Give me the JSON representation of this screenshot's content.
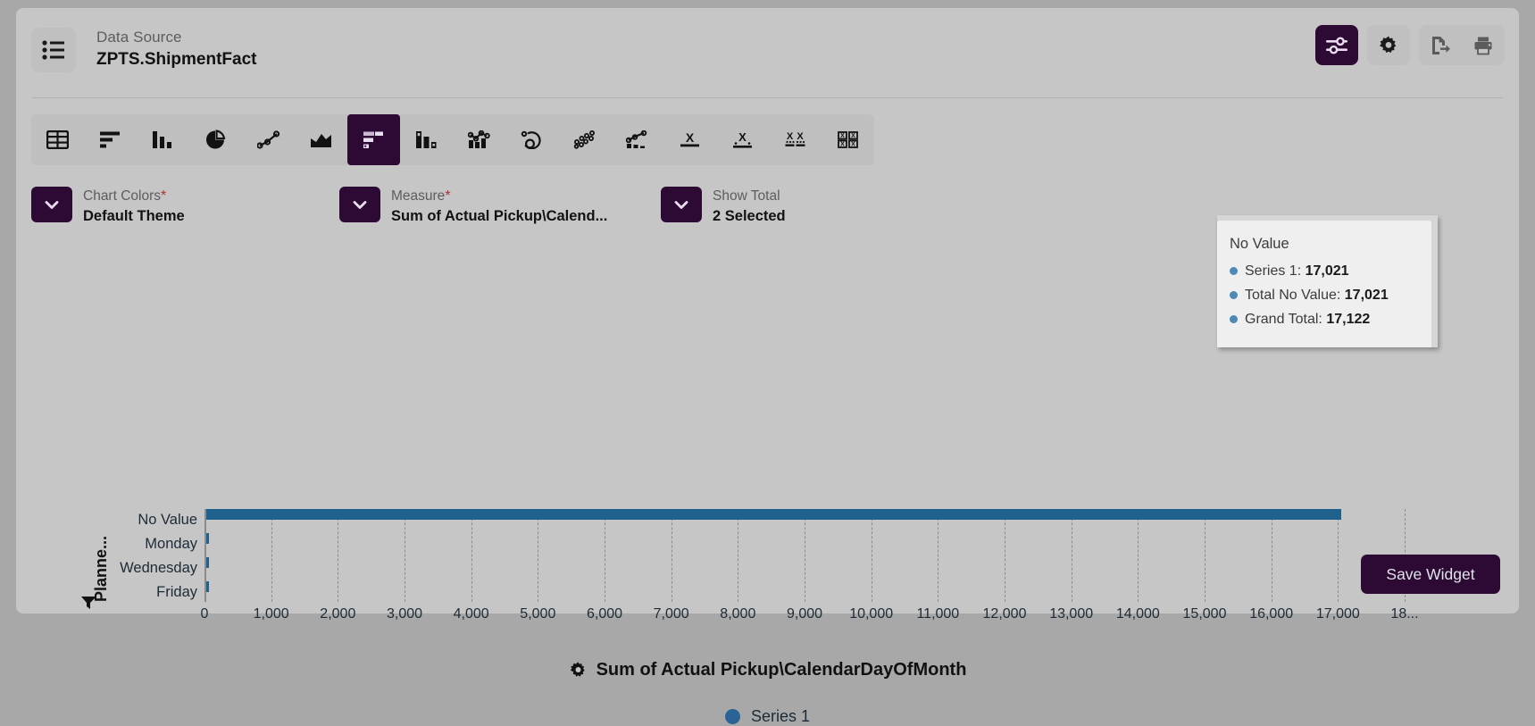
{
  "header": {
    "datasource_label": "Data Source",
    "datasource_value": "ZPTS.ShipmentFact",
    "list_icon": "list-icon",
    "actions": [
      {
        "name": "filter-settings-icon",
        "style": "accent"
      },
      {
        "name": "gear-icon",
        "style": "plain"
      },
      {
        "name": "export-icon",
        "style": "flat"
      },
      {
        "name": "print-icon",
        "style": "flat"
      }
    ]
  },
  "chart_types": [
    {
      "name": "table-chart-icon",
      "selected": false
    },
    {
      "name": "horizontal-bar-chart-icon",
      "selected": false
    },
    {
      "name": "column-chart-icon",
      "selected": false
    },
    {
      "name": "pie-chart-icon",
      "selected": false
    },
    {
      "name": "line-chart-icon",
      "selected": false
    },
    {
      "name": "area-chart-icon",
      "selected": false
    },
    {
      "name": "stacked-bar-chart-icon",
      "selected": true
    },
    {
      "name": "grouped-column-chart-icon",
      "selected": false
    },
    {
      "name": "combo-chart-icon",
      "selected": false
    },
    {
      "name": "donut-gauge-chart-icon",
      "selected": false
    },
    {
      "name": "bubble-chart-icon",
      "selected": false
    },
    {
      "name": "line-column-chart-icon",
      "selected": false
    },
    {
      "name": "kpi-single-icon",
      "selected": false
    },
    {
      "name": "kpi-trend-icon",
      "selected": false
    },
    {
      "name": "kpi-multi-icon",
      "selected": false
    },
    {
      "name": "kpi-grid-icon",
      "selected": false
    }
  ],
  "config": [
    {
      "label": "Chart Colors",
      "required": "*",
      "value": "Default Theme",
      "caret": "chevron-down-icon"
    },
    {
      "label": "Measure",
      "required": "*",
      "value": "Sum of Actual Pickup\\Calend...",
      "caret": "chevron-down-icon"
    },
    {
      "label": "Show Total",
      "required": "",
      "value": "2 Selected",
      "caret": "chevron-down-icon"
    }
  ],
  "tooltip": {
    "title": "No Value",
    "rows": [
      {
        "label": "Series 1:",
        "value": "17,021"
      },
      {
        "label": "Total No Value:",
        "value": "17,021"
      },
      {
        "label": "Grand Total:",
        "value": "17,122"
      }
    ]
  },
  "footer": {
    "save_label": "Save Widget"
  },
  "chart_data": {
    "type": "bar",
    "orientation": "horizontal",
    "title": "",
    "xlabel": "Sum of Actual Pickup\\CalendarDayOfMonth",
    "ylabel": "Planne...",
    "ylabel_full": "Planned Pickup Day",
    "categories": [
      "No Value",
      "Monday",
      "Wednesday",
      "Friday"
    ],
    "series": [
      {
        "name": "Series 1",
        "color": "#1f628e",
        "values": [
          17021,
          34,
          41,
          26
        ]
      }
    ],
    "xlim": [
      0,
      18000
    ],
    "xticks": [
      0,
      1000,
      2000,
      3000,
      4000,
      5000,
      6000,
      7000,
      8000,
      9000,
      10000,
      11000,
      12000,
      13000,
      14000,
      15000,
      16000,
      17000,
      18000
    ],
    "xtick_labels": [
      "0",
      "1,000",
      "2,000",
      "3,000",
      "4,000",
      "5,000",
      "6,000",
      "7,000",
      "8,000",
      "9,000",
      "10,000",
      "11,000",
      "12,000",
      "13,000",
      "14,000",
      "15,000",
      "16,000",
      "17,000",
      "18..."
    ],
    "grid": true,
    "grid_style": "dashed-vertical",
    "legend": {
      "position": "bottom",
      "entries": [
        {
          "label": "Series 1",
          "color": "#2a6496"
        }
      ]
    },
    "axis_title_icon": "gear-icon",
    "y_axis_filter_icon": "filter-icon",
    "grand_total": 17122
  },
  "colors": {
    "accent": "#2d0a33",
    "series1": "#1f628e",
    "page_bg": "#c6c6c6",
    "toolbar_bg": "#bfbfbf"
  }
}
